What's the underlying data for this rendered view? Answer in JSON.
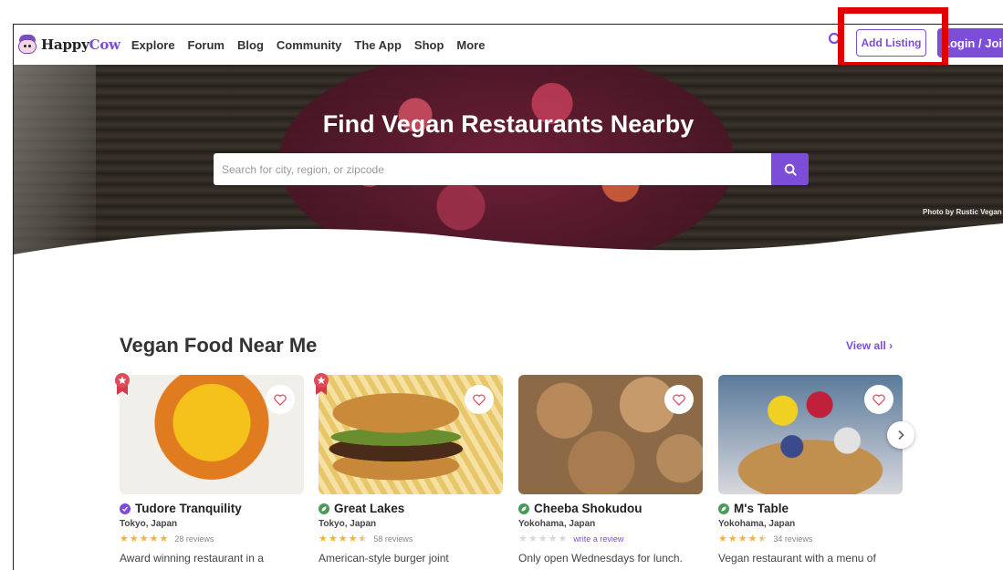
{
  "header": {
    "logo": {
      "happy": "Happy",
      "cow": "Cow"
    },
    "nav": [
      "Explore",
      "Forum",
      "Blog",
      "Community",
      "The App",
      "Shop",
      "More"
    ],
    "add_listing": "Add Listing",
    "login_join": "Login / Join"
  },
  "hero": {
    "title": "Find Vegan Restaurants Nearby",
    "search_placeholder": "Search for city, region, or zipcode",
    "photo_credit": "Photo by Rustic Vegan"
  },
  "section": {
    "title": "Vegan Food Near Me",
    "view_all": "View all"
  },
  "cards": [
    {
      "name": "Tudore Tranquility",
      "location": "Tokyo, Japan",
      "rating": 5,
      "reviews": "28 reviews",
      "description": "Award winning restaurant in a",
      "badge": "purple",
      "featured": true
    },
    {
      "name": "Great Lakes",
      "location": "Tokyo, Japan",
      "rating": 4.5,
      "reviews": "58 reviews",
      "description": "American-style burger joint",
      "badge": "green",
      "featured": true
    },
    {
      "name": "Cheeba Shokudou",
      "location": "Yokohama, Japan",
      "rating": 0,
      "reviews": "write a review",
      "description": "Only open Wednesdays for lunch.",
      "badge": "green",
      "featured": false
    },
    {
      "name": "M's Table",
      "location": "Yokohama, Japan",
      "rating": 4.5,
      "reviews": "34 reviews",
      "description": "Vegan restaurant with a menu of",
      "badge": "green",
      "featured": false
    }
  ],
  "colors": {
    "accent": "#7c4dd6",
    "highlight": "#e00000",
    "star": "#f3b626"
  }
}
